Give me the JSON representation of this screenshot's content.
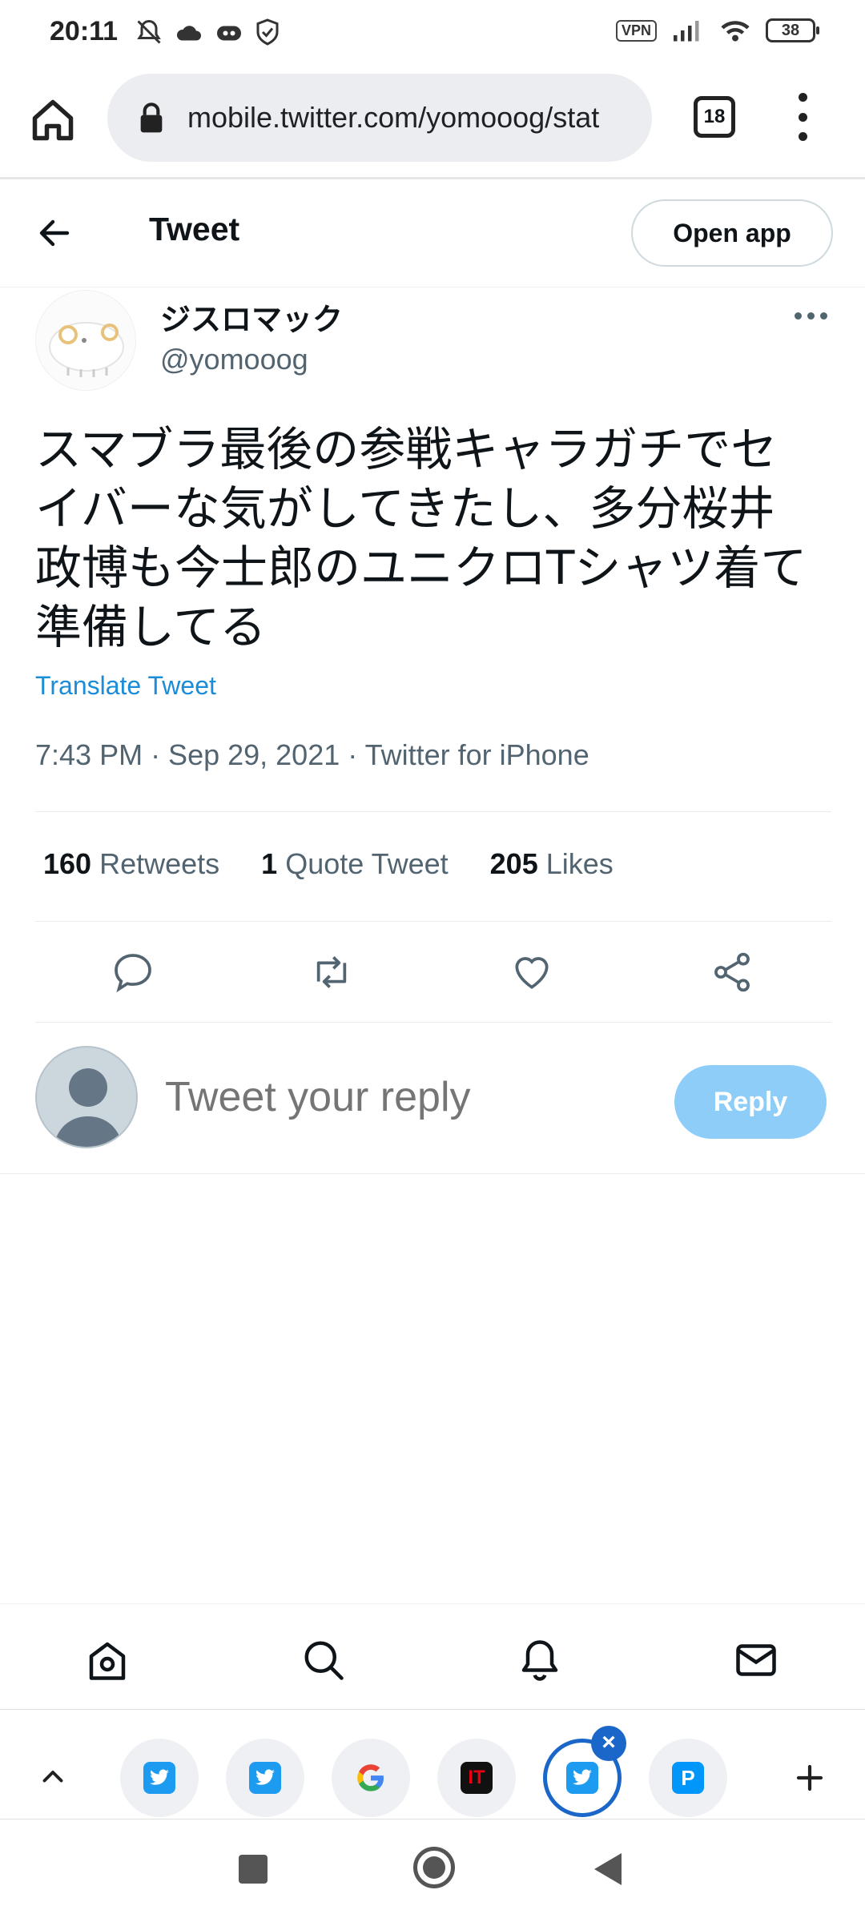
{
  "status_bar": {
    "time": "20:11",
    "vpn_label": "VPN",
    "battery_level": "38"
  },
  "browser": {
    "url": "mobile.twitter.com/yomooog/stat",
    "tab_count": "18"
  },
  "header": {
    "title": "Tweet",
    "open_app_label": "Open app"
  },
  "tweet": {
    "display_name": "ジスロマック",
    "handle": "@yomooog",
    "text": "スマブラ最後の参戦キャラガチでセイバーな気がしてきたし、多分桜井政博も今士郎のユニクロTシャツ着て準備してる",
    "translate_label": "Translate Tweet",
    "timestamp": "7:43 PM · Sep 29, 2021 · Twitter for iPhone"
  },
  "stats": {
    "retweets_count": "160",
    "retweets_label": "Retweets",
    "quote_count": "1",
    "quote_label": "Quote Tweet",
    "likes_count": "205",
    "likes_label": "Likes"
  },
  "reply": {
    "placeholder": "Tweet your reply",
    "button_label": "Reply"
  },
  "icons": {
    "actions": [
      "reply-icon",
      "retweet-icon",
      "like-icon",
      "share-icon"
    ],
    "bottom_nav": [
      "home-icon",
      "search-icon",
      "notifications-icon",
      "messages-icon"
    ],
    "tabs": [
      "twitter-favicon",
      "twitter-favicon",
      "google-favicon",
      "itmedia-favicon",
      "twitter-favicon",
      "pixiv-favicon"
    ]
  },
  "colors": {
    "accent": "#1d9bf0",
    "reply_button": "#8ecdf8",
    "active_tab_ring": "#1a66c9"
  }
}
